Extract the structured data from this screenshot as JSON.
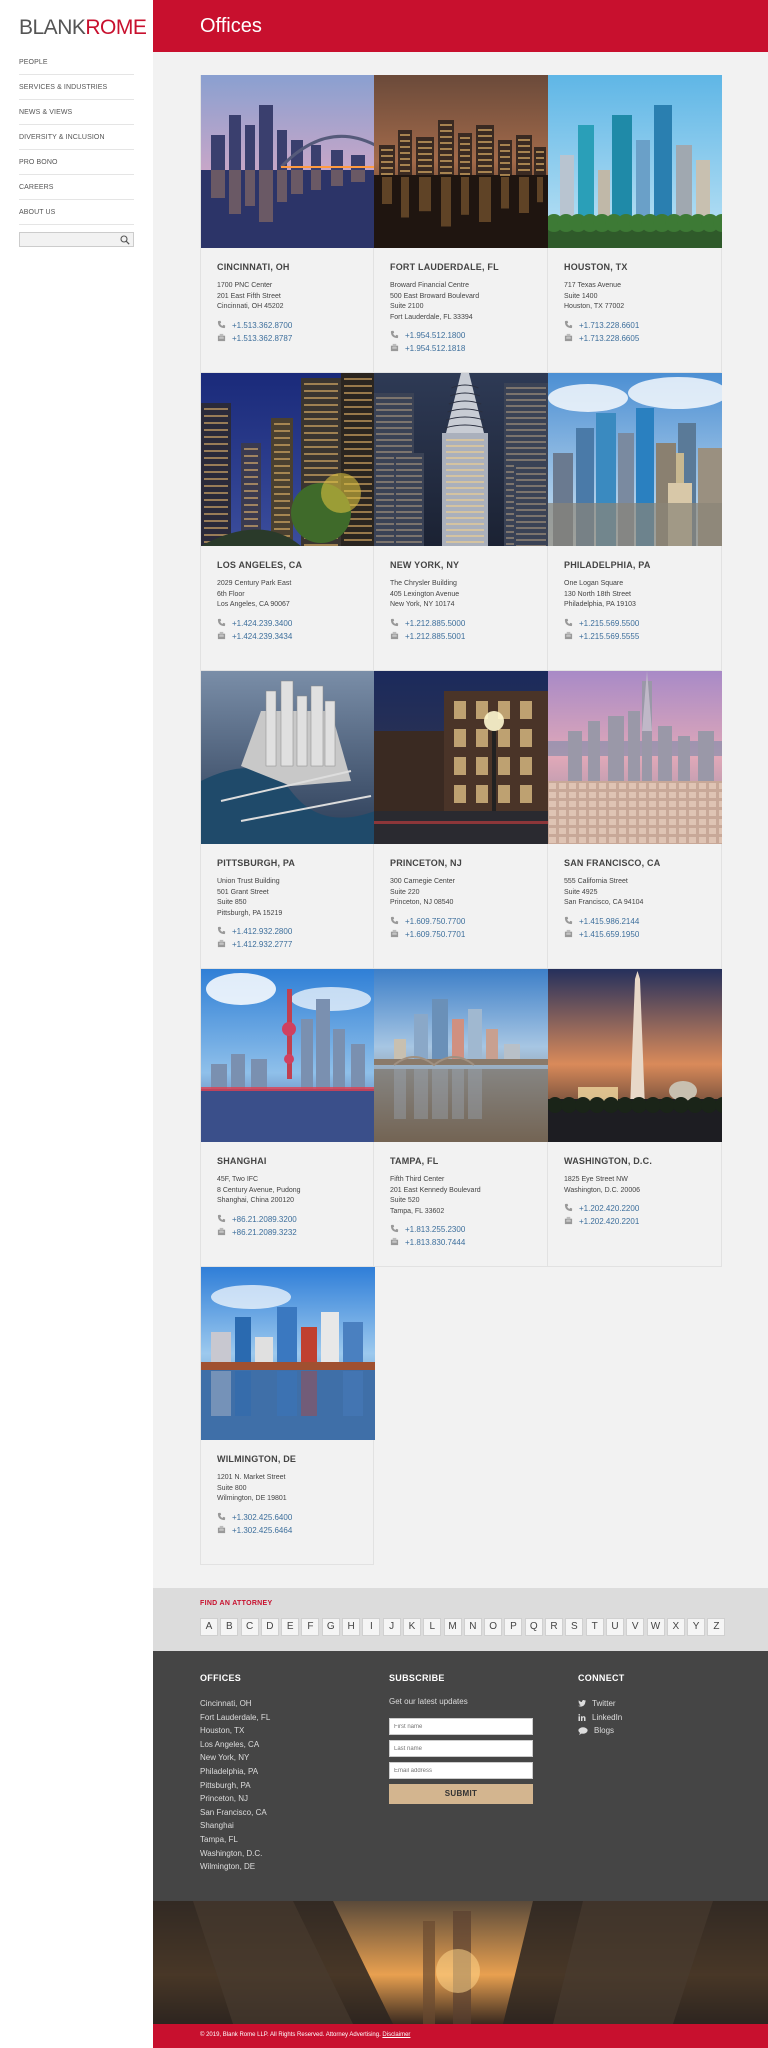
{
  "logo": {
    "blank": "BLANK",
    "rome": "ROME"
  },
  "nav": [
    "PEOPLE",
    "SERVICES & INDUSTRIES",
    "NEWS & VIEWS",
    "DIVERSITY & INCLUSION",
    "PRO BONO",
    "CAREERS",
    "ABOUT US"
  ],
  "search": {
    "placeholder": ""
  },
  "header": {
    "title": "Offices"
  },
  "offices": [
    {
      "city": "CINCINNATI, OH",
      "address": [
        "1700 PNC Center",
        "201 East Fifth Street",
        "Cincinnati, OH 45202"
      ],
      "phone": "+1.513.362.8700",
      "fax": "+1.513.362.8787"
    },
    {
      "city": "FORT LAUDERDALE, FL",
      "address": [
        "Broward Financial Centre",
        "500 East Broward Boulevard",
        "Suite 2100",
        "Fort Lauderdale, FL 33394"
      ],
      "phone": "+1.954.512.1800",
      "fax": "+1.954.512.1818"
    },
    {
      "city": "HOUSTON, TX",
      "address": [
        "717 Texas Avenue",
        "Suite 1400",
        "Houston, TX 77002"
      ],
      "phone": "+1.713.228.6601",
      "fax": "+1.713.228.6605"
    },
    {
      "city": "LOS ANGELES, CA",
      "address": [
        "2029 Century Park East",
        "6th Floor",
        "Los Angeles, CA 90067"
      ],
      "phone": "+1.424.239.3400",
      "fax": "+1.424.239.3434"
    },
    {
      "city": "NEW YORK, NY",
      "address": [
        "The Chrysler Building",
        "405 Lexington Avenue",
        "New York, NY 10174"
      ],
      "phone": "+1.212.885.5000",
      "fax": "+1.212.885.5001"
    },
    {
      "city": "PHILADELPHIA, PA",
      "address": [
        "One Logan Square",
        "130 North 18th Street",
        "Philadelphia, PA 19103"
      ],
      "phone": "+1.215.569.5500",
      "fax": "+1.215.569.5555"
    },
    {
      "city": "PITTSBURGH, PA",
      "address": [
        "Union Trust Building",
        "501 Grant Street",
        "Suite 850",
        "Pittsburgh, PA 15219"
      ],
      "phone": "+1.412.932.2800",
      "fax": "+1.412.932.2777"
    },
    {
      "city": "PRINCETON, NJ",
      "address": [
        "300 Carnegie Center",
        "Suite 220",
        "Princeton, NJ 08540"
      ],
      "phone": "+1.609.750.7700",
      "fax": "+1.609.750.7701"
    },
    {
      "city": "SAN FRANCISCO, CA",
      "address": [
        "555 California Street",
        "Suite 4925",
        "San Francisco, CA 94104"
      ],
      "phone": "+1.415.986.2144",
      "fax": "+1.415.659.1950"
    },
    {
      "city": "SHANGHAI",
      "address": [
        "45F, Two IFC",
        "8 Century Avenue, Pudong",
        "Shanghai, China 200120"
      ],
      "phone": "+86.21.2089.3200",
      "fax": "+86.21.2089.3232"
    },
    {
      "city": "TAMPA, FL",
      "address": [
        "Fifth Third Center",
        "201 East Kennedy Boulevard",
        "Suite 520",
        "Tampa, FL 33602"
      ],
      "phone": "+1.813.255.2300",
      "fax": "+1.813.830.7444"
    },
    {
      "city": "WASHINGTON, D.C.",
      "address": [
        "1825 Eye Street NW",
        "Washington, D.C. 20006"
      ],
      "phone": "+1.202.420.2200",
      "fax": "+1.202.420.2201"
    },
    {
      "city": "WILMINGTON, DE",
      "address": [
        "1201 N. Market Street",
        "Suite 800",
        "Wilmington, DE 19801"
      ],
      "phone": "+1.302.425.6400",
      "fax": "+1.302.425.6464"
    }
  ],
  "find_attorney": {
    "title": "FIND AN ATTORNEY",
    "letters": [
      "A",
      "B",
      "C",
      "D",
      "E",
      "F",
      "G",
      "H",
      "I",
      "J",
      "K",
      "L",
      "M",
      "N",
      "O",
      "P",
      "Q",
      "R",
      "S",
      "T",
      "U",
      "V",
      "W",
      "X",
      "Y",
      "Z"
    ]
  },
  "footer": {
    "offices_title": "OFFICES",
    "offices": [
      "Cincinnati, OH",
      "Fort Lauderdale, FL",
      "Houston, TX",
      "Los Angeles, CA",
      "New York, NY",
      "Philadelphia, PA",
      "Pittsburgh, PA",
      "Princeton, NJ",
      "San Francisco, CA",
      "Shanghai",
      "Tampa, FL",
      "Washington, D.C.",
      "Wilmington, DE"
    ],
    "subscribe_title": "SUBSCRIBE",
    "subscribe_text": "Get our latest updates",
    "first_name_placeholder": "First name",
    "last_name_placeholder": "Last name",
    "email_placeholder": "Email address",
    "submit_label": "SUBMIT",
    "connect_title": "CONNECT",
    "connect": [
      {
        "label": "Twitter",
        "icon": "twitter-icon"
      },
      {
        "label": "LinkedIn",
        "icon": "linkedin-icon"
      },
      {
        "label": "Blogs",
        "icon": "blogs-icon"
      }
    ]
  },
  "copyright": {
    "text": "© 2019, Blank Rome LLP. All Rights Reserved. Attorney Advertising.",
    "disclaimer": "Disclaimer"
  },
  "colors": {
    "brand_red": "#c8102e",
    "link_blue": "#3d6f9c",
    "footer_bg": "#454545",
    "button_tan": "#d3b58f"
  }
}
